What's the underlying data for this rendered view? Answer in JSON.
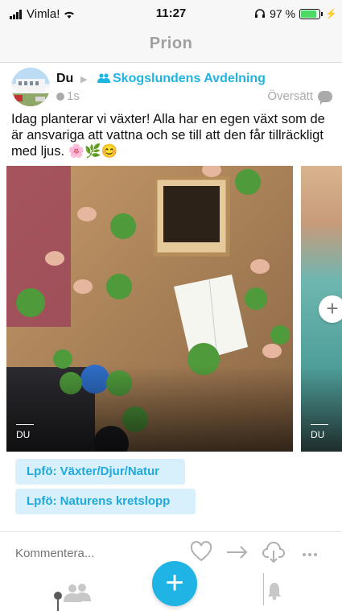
{
  "status_bar": {
    "carrier": "Vimla!",
    "time": "11:27",
    "battery_percent": "97 %"
  },
  "nav": {
    "title": "Prion"
  },
  "post": {
    "author": "Du",
    "group": "Skogslundens Avdelning",
    "time_ago": "1s",
    "translate_label": "Översätt",
    "text": "Idag planterar vi växter! Alla har en egen växt som de är ansvariga att vattna och se till att den får tillräckligt med ljus. 🌸🌿😊",
    "images": [
      {
        "label": "DU"
      },
      {
        "label": "DU"
      }
    ],
    "tags": [
      "Lpfö: Växter/Djur/Natur",
      "Lpfö: Naturens kretslopp"
    ]
  },
  "comment": {
    "placeholder": "Kommentera..."
  },
  "icons": {
    "actions": [
      "heart-icon",
      "share-arrow-icon",
      "download-cloud-icon",
      "more-icon"
    ],
    "tabs": [
      "group-icon",
      "add-icon",
      "bell-icon"
    ]
  },
  "colors": {
    "accent": "#1fb4e4",
    "tag_bg": "#d7f0fb",
    "battery": "#4cd964"
  }
}
